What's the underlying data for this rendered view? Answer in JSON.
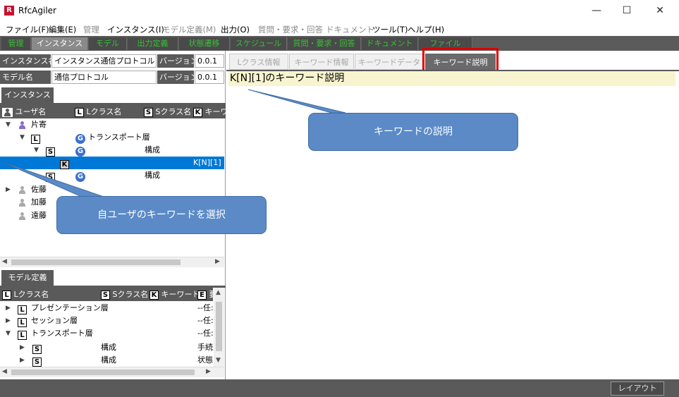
{
  "window": {
    "title": "RfcAgiler",
    "logo_letter": "R",
    "minimize": "—",
    "maximize": "☐",
    "close": "✕"
  },
  "menu": [
    {
      "label": "ファイル(F)",
      "enabled": true
    },
    {
      "label": "編集(E)",
      "enabled": true
    },
    {
      "label": "管理",
      "enabled": false
    },
    {
      "label": "インスタンス(I)",
      "enabled": true
    },
    {
      "label": "モデル定義(M)",
      "enabled": false
    },
    {
      "label": "出力(O)",
      "enabled": true
    },
    {
      "label": "質問・要求・回答",
      "enabled": false
    },
    {
      "label": "ドキュメント",
      "enabled": false
    },
    {
      "label": "ツール(T)",
      "enabled": true
    },
    {
      "label": "ヘルプ(H)",
      "enabled": true
    }
  ],
  "main_tabs": [
    "管理",
    "インスタンス",
    "モデル",
    "出力定義",
    "状態遷移",
    "スケジュール",
    "質問・要求・回答",
    "ドキュメント",
    "ファイル"
  ],
  "main_tabs_active": "インスタンス",
  "instance_info": {
    "instance_label": "インスタンス名",
    "instance_value": "インスタンス通信プロトコル",
    "version_label": "バージョン",
    "instance_version": "0.0.1",
    "model_label": "モデル名",
    "model_value": "通信プロトコル",
    "model_version": "0.0.1"
  },
  "instance_panel": {
    "tab": "インスタンス",
    "columns": {
      "user": "ユーザ名",
      "lclass": "Lクラス名",
      "sclass": "Sクラス名",
      "keyword": "キーワ"
    },
    "col_badges": {
      "lclass": "L",
      "sclass": "S",
      "keyword": "K"
    },
    "tree": {
      "user1": "片寄",
      "lclass_badge": "L",
      "lclass_name": "トランスポート層",
      "sclass_badge": "S",
      "sclass_name": "構成",
      "keyword_badge": "K",
      "keyword_value": "K[N][1]",
      "sclass2_name": "構成",
      "g_letter": "G",
      "users": [
        "佐藤",
        "加藤",
        "遠藤"
      ]
    }
  },
  "model_panel": {
    "tab": "モデル定義",
    "columns": {
      "lclass": "Lクラス名",
      "sclass": "Sクラス名",
      "keyword": "キーワード",
      "e": "要"
    },
    "col_badges": {
      "lclass": "L",
      "sclass": "S",
      "keyword": "K",
      "e": "E"
    },
    "rows": [
      {
        "badge": "L",
        "name": "プレゼンテーション層",
        "sclass": "",
        "extra": "--任:"
      },
      {
        "badge": "L",
        "name": "セッション層",
        "sclass": "",
        "extra": "--任:"
      },
      {
        "badge": "L",
        "name": "トランスポート層",
        "sclass": "",
        "extra": "--任:"
      },
      {
        "badge": "S",
        "name": "",
        "sclass": "構成",
        "extra": "手続"
      },
      {
        "badge": "S",
        "name": "",
        "sclass": "構成",
        "extra": "状態"
      }
    ]
  },
  "right_tabs": [
    "Lクラス情報",
    "キーワード情報",
    "キーワードデータ",
    "キーワード説明"
  ],
  "right_tabs_active": "キーワード説明",
  "keyword_title": "K[N][1]のキーワード説明",
  "callouts": {
    "right": "キーワードの説明",
    "left": "自ユーザのキーワードを選択"
  },
  "status": {
    "layout_button": "レイアウト"
  },
  "colors": {
    "accent_green": "#36c236",
    "selection": "#0078d7",
    "callout": "#5b8ac7",
    "highlight_red": "#e00000",
    "keyword_bg": "#f7f4cf"
  }
}
